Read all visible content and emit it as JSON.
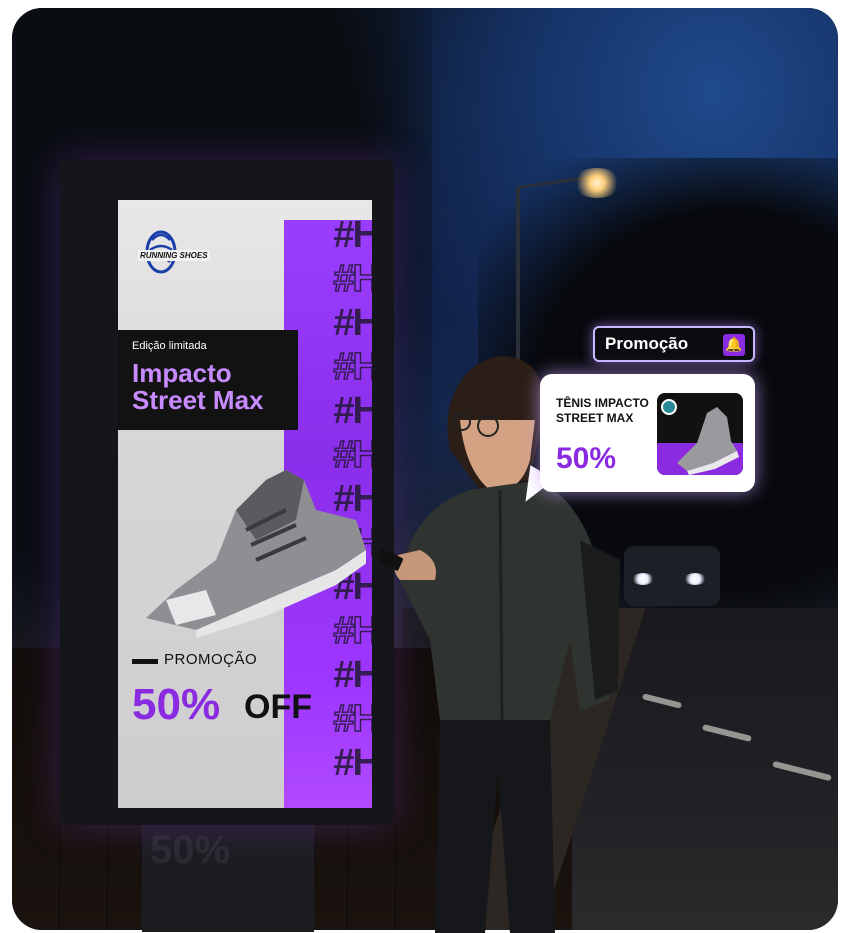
{
  "billboard": {
    "brand": "RUNNING SHOES",
    "eyebrow": "Edição limitada",
    "title": "Impacto Street Max",
    "hashtag": "#H",
    "promo_label": "PROMOÇÃO",
    "promo_percent": "50%",
    "promo_off": "OFF",
    "post_text": "50%"
  },
  "notification": {
    "label": "Promoção",
    "bell_icon": "bell-icon",
    "card_title": "TÊNIS IMPACTO STREET MAX",
    "card_percent": "50%"
  },
  "colors": {
    "accent": "#8a2be2",
    "accent_light": "#c78bff",
    "strip": "#9b3dff"
  }
}
